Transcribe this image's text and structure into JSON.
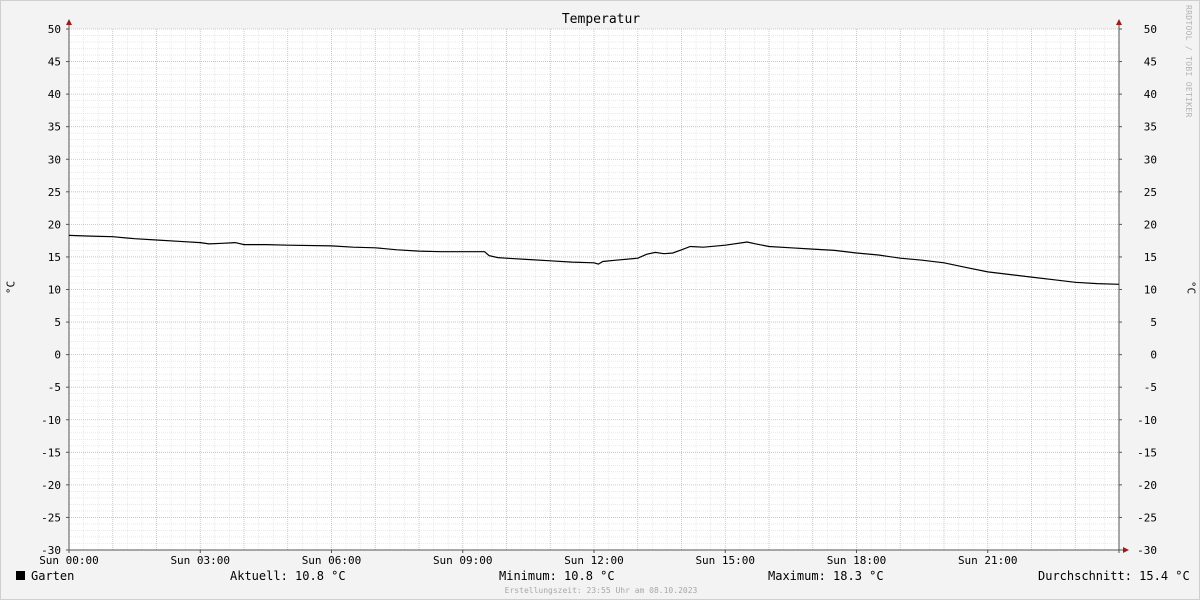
{
  "watermark": "RRDTOOL / TOBI OETIKER",
  "legend": {
    "series_label": "Garten",
    "aktuell": "Aktuell: 10.8 °C",
    "minimum": "Minimum: 10.8 °C",
    "maximum": "Maximum: 18.3 °C",
    "durchschnitt": "Durchschnitt: 15.4 °C"
  },
  "footer": "Erstellungszeit: 23:55 Uhr am 08.10.2023",
  "colors": {
    "background": "#f3f3f3",
    "canvas": "#ffffff",
    "major_grid": "#f4a6a6",
    "minor_grid": "#dcdcdc",
    "line": "#000000",
    "axis_arrow": "#9b1c1c"
  },
  "chart_data": {
    "type": "line",
    "title": "Temperatur",
    "ylabel": "°C",
    "ylabel_right": "°C",
    "ylim": [
      -30,
      50
    ],
    "ytick_step": 5,
    "yticks": [
      "50",
      "45",
      "40",
      "35",
      "30",
      "25",
      "20",
      "15",
      "10",
      "5",
      "0",
      "-5",
      "-10",
      "-15",
      "-20",
      "-25",
      "-30"
    ],
    "xlim": [
      0,
      24
    ],
    "xticks": [
      {
        "x": 0,
        "label": "Sun 00:00"
      },
      {
        "x": 3,
        "label": "Sun 03:00"
      },
      {
        "x": 6,
        "label": "Sun 06:00"
      },
      {
        "x": 9,
        "label": "Sun 09:00"
      },
      {
        "x": 12,
        "label": "Sun 12:00"
      },
      {
        "x": 15,
        "label": "Sun 15:00"
      },
      {
        "x": 18,
        "label": "Sun 18:00"
      },
      {
        "x": 21,
        "label": "Sun 21:00"
      }
    ],
    "grid": true,
    "legend_position": "bottom",
    "series": [
      {
        "name": "Garten",
        "x": [
          0,
          0.5,
          1,
          1.5,
          2,
          2.5,
          3,
          3.2,
          3.5,
          3.8,
          4,
          4.5,
          5,
          6,
          6.5,
          7,
          7.5,
          8,
          8.5,
          9,
          9.5,
          9.6,
          9.8,
          10,
          10.5,
          11,
          11.5,
          12,
          12.1,
          12.2,
          12.5,
          13,
          13.2,
          13.4,
          13.6,
          13.8,
          14,
          14.2,
          14.5,
          15,
          15.5,
          15.7,
          16,
          16.5,
          17,
          17.5,
          18,
          18.5,
          19,
          19.5,
          20,
          20.5,
          21,
          21.5,
          22,
          22.5,
          23,
          23.5,
          24
        ],
        "y": [
          18.3,
          18.2,
          18.1,
          17.8,
          17.6,
          17.4,
          17.2,
          17.0,
          17.1,
          17.2,
          16.9,
          16.9,
          16.8,
          16.7,
          16.5,
          16.4,
          16.1,
          15.9,
          15.8,
          15.8,
          15.8,
          15.2,
          14.9,
          14.8,
          14.6,
          14.4,
          14.2,
          14.1,
          13.9,
          14.3,
          14.5,
          14.8,
          15.4,
          15.7,
          15.5,
          15.6,
          16.1,
          16.6,
          16.5,
          16.8,
          17.3,
          17.0,
          16.6,
          16.4,
          16.2,
          16.0,
          15.6,
          15.3,
          14.8,
          14.5,
          14.1,
          13.4,
          12.7,
          12.3,
          11.9,
          11.5,
          11.1,
          10.9,
          10.8
        ]
      }
    ]
  }
}
